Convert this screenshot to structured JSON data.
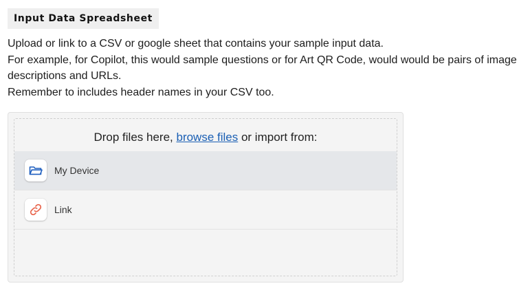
{
  "section": {
    "title": "Input Data Spreadsheet"
  },
  "description": {
    "line1": "Upload or link to a CSV or google sheet that contains your sample input data.",
    "line2": "For example, for Copilot, this would sample questions or for Art QR Code, would would be pairs of image descriptions and URLs.",
    "line3": "Remember to includes header names in your CSV too."
  },
  "uploader": {
    "drop_prefix": "Drop files here, ",
    "browse_label": "browse files",
    "drop_suffix": " or import from:",
    "sources": [
      {
        "label": "My Device",
        "icon": "folder-icon",
        "active": true
      },
      {
        "label": "Link",
        "icon": "link-icon",
        "active": false
      }
    ]
  },
  "colors": {
    "link": "#1a5fb4",
    "folder_icon": "#1f5fbf",
    "link_icon": "#e8634a",
    "active_row": "#e5e7ea"
  }
}
